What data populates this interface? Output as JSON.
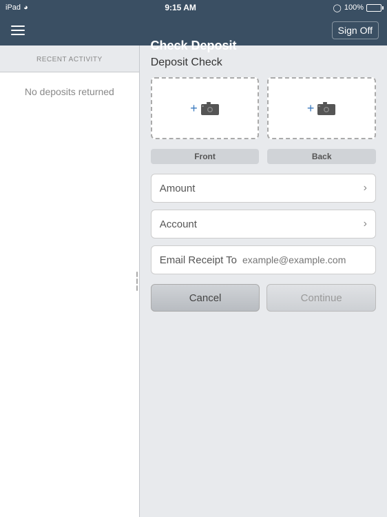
{
  "statusBar": {
    "device": "iPad",
    "wifi": "▾",
    "time": "9:15 AM",
    "battery_percent": "100%",
    "battery_icon": "🔋"
  },
  "navBar": {
    "title": "Check Deposit",
    "menu_label": "menu",
    "signoff_label": "Sign Off"
  },
  "leftPanel": {
    "recent_activity_label": "RECENT ACTIVITY",
    "no_deposits_text": "No deposits returned"
  },
  "rightPanel": {
    "deposit_check_title": "Deposit Check",
    "front_label": "Front",
    "back_label": "Back",
    "amount_label": "Amount",
    "account_label": "Account",
    "email_receipt_label": "Email Receipt To",
    "email_placeholder": "example@example.com",
    "cancel_label": "Cancel",
    "continue_label": "Continue"
  }
}
